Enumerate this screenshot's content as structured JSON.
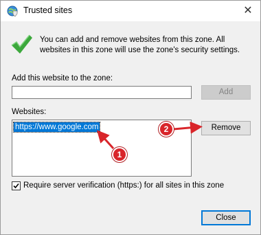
{
  "window": {
    "title": "Trusted sites",
    "icons": {
      "app": "globe-shield-icon",
      "close": "close-icon",
      "status": "green-checkmark-icon"
    }
  },
  "intro_text": "You can add and remove websites from this zone. All websites in this zone will use the zone's security settings.",
  "add_section": {
    "label": "Add this website to the zone:",
    "input_value": "",
    "add_button": "Add"
  },
  "websites_section": {
    "label": "Websites:",
    "items": [
      "https://www.google.com"
    ],
    "remove_button": "Remove"
  },
  "require_verification": {
    "checked": true,
    "label": "Require server verification (https:) for all sites in this zone"
  },
  "close_button": "Close",
  "annotations": [
    {
      "number": "1"
    },
    {
      "number": "2"
    }
  ],
  "colors": {
    "selection": "#0078d7",
    "annotation": "#d9252a"
  }
}
